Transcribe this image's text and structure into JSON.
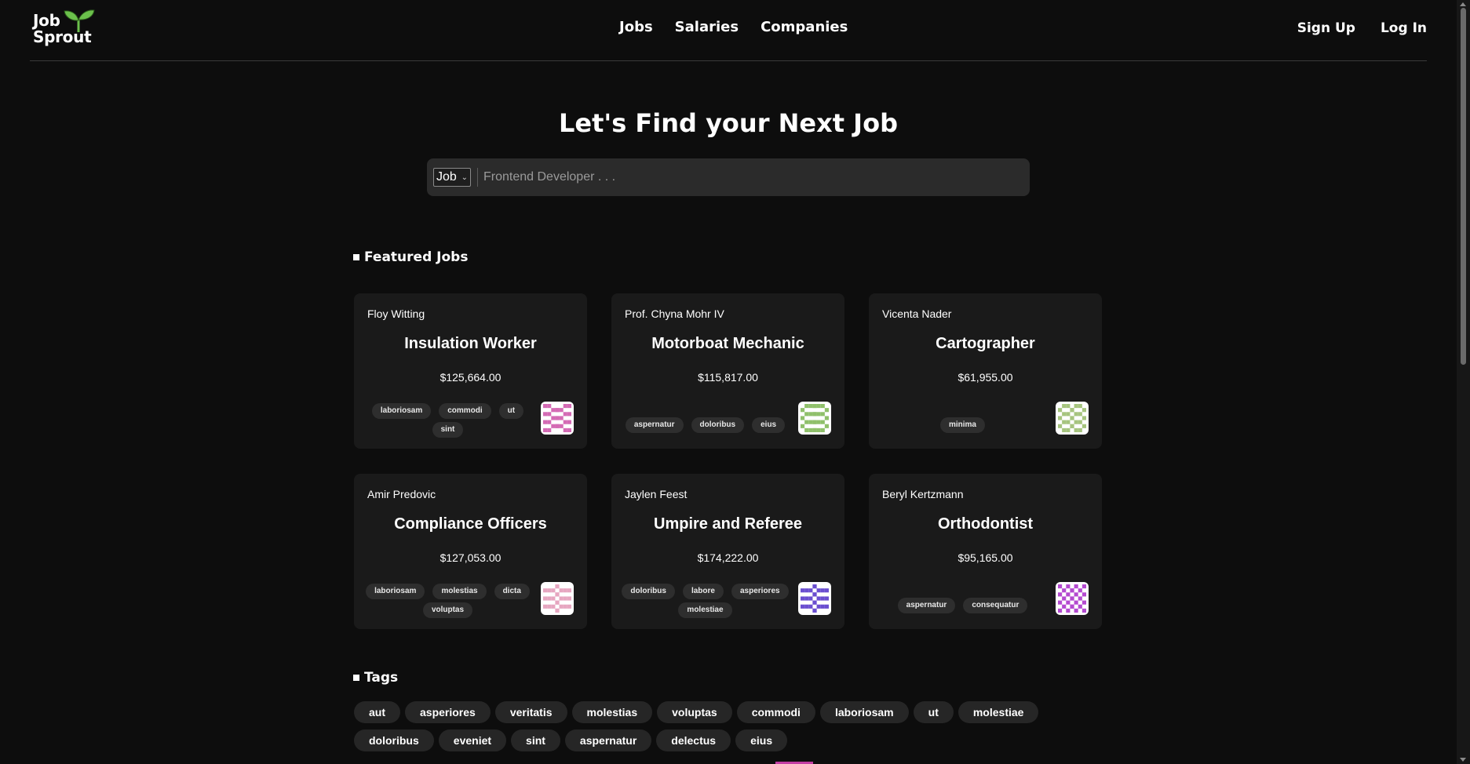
{
  "brand": {
    "logo_text_line1": "Job",
    "logo_text_line2": "Sprout",
    "logo_icon": "sprout-icon",
    "sprout_color": "#6bc04b"
  },
  "nav": {
    "jobs": "Jobs",
    "salaries": "Salaries",
    "companies": "Companies"
  },
  "auth": {
    "sign_up": "Sign Up",
    "log_in": "Log In"
  },
  "hero": {
    "title": "Let's Find your Next Job"
  },
  "search": {
    "type_selected": "Job",
    "placeholder": "Frontend Developer . . ."
  },
  "featured": {
    "heading": "Featured Jobs",
    "jobs": [
      {
        "company": "Floy Witting",
        "title": "Insulation Worker",
        "salary": "$125,664.00",
        "tags": [
          "laboriosam",
          "commodi",
          "ut",
          "sint"
        ],
        "avatar_color": "#d46ab4"
      },
      {
        "company": "Prof. Chyna Mohr IV",
        "title": "Motorboat Mechanic",
        "salary": "$115,817.00",
        "tags": [
          "aspernatur",
          "doloribus",
          "eius"
        ],
        "avatar_color": "#8fc06a"
      },
      {
        "company": "Vicenta Nader",
        "title": "Cartographer",
        "salary": "$61,955.00",
        "tags": [
          "minima"
        ],
        "avatar_color": "#a6c47e"
      },
      {
        "company": "Amir Predovic",
        "title": "Compliance Officers",
        "salary": "$127,053.00",
        "tags": [
          "laboriosam",
          "molestias",
          "dicta",
          "voluptas"
        ],
        "avatar_color": "#e6a6c0"
      },
      {
        "company": "Jaylen Feest",
        "title": "Umpire and Referee",
        "salary": "$174,222.00",
        "tags": [
          "doloribus",
          "labore",
          "asperiores",
          "molestiae"
        ],
        "avatar_color": "#6a4ed0"
      },
      {
        "company": "Beryl Kertzmann",
        "title": "Orthodontist",
        "salary": "$95,165.00",
        "tags": [
          "aspernatur",
          "consequatur"
        ],
        "avatar_color": "#b44ad0"
      }
    ]
  },
  "tags_section": {
    "heading": "Tags",
    "tags": [
      "aut",
      "asperiores",
      "veritatis",
      "molestias",
      "voluptas",
      "commodi",
      "laboriosam",
      "ut",
      "molestiae",
      "doloribus",
      "eveniet",
      "sint",
      "aspernatur",
      "delectus",
      "eius"
    ]
  }
}
